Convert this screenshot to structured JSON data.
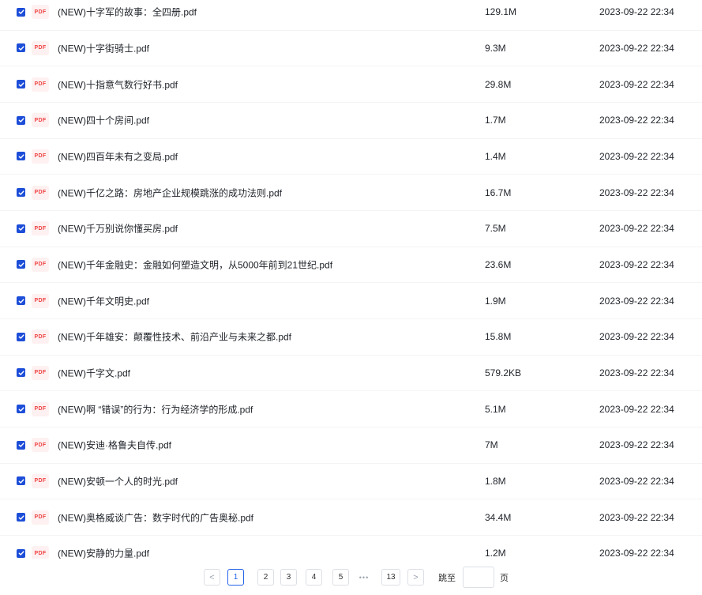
{
  "files": [
    {
      "icon": "pdf-file-icon",
      "badge": "PDF",
      "name": "(NEW)十字军的故事：全四册.pdf",
      "size": "129.1M",
      "date": "2023-09-22 22:34",
      "checked": true
    },
    {
      "icon": "pdf-file-icon",
      "badge": "PDF",
      "name": "(NEW)十字街骑士.pdf",
      "size": "9.3M",
      "date": "2023-09-22 22:34",
      "checked": true
    },
    {
      "icon": "pdf-file-icon",
      "badge": "PDF",
      "name": "(NEW)十指意气数行好书.pdf",
      "size": "29.8M",
      "date": "2023-09-22 22:34",
      "checked": true
    },
    {
      "icon": "pdf-file-icon",
      "badge": "PDF",
      "name": "(NEW)四十个房间.pdf",
      "size": "1.7M",
      "date": "2023-09-22 22:34",
      "checked": true
    },
    {
      "icon": "pdf-file-icon",
      "badge": "PDF",
      "name": "(NEW)四百年未有之变局.pdf",
      "size": "1.4M",
      "date": "2023-09-22 22:34",
      "checked": true
    },
    {
      "icon": "pdf-file-icon",
      "badge": "PDF",
      "name": "(NEW)千亿之路：房地产企业规模跳涨的成功法则.pdf",
      "size": "16.7M",
      "date": "2023-09-22 22:34",
      "checked": true
    },
    {
      "icon": "pdf-file-icon",
      "badge": "PDF",
      "name": "(NEW)千万别说你懂买房.pdf",
      "size": "7.5M",
      "date": "2023-09-22 22:34",
      "checked": true
    },
    {
      "icon": "pdf-file-icon",
      "badge": "PDF",
      "name": "(NEW)千年金融史：金融如何塑造文明，从5000年前到21世纪.pdf",
      "size": "23.6M",
      "date": "2023-09-22 22:34",
      "checked": true
    },
    {
      "icon": "pdf-file-icon",
      "badge": "PDF",
      "name": "(NEW)千年文明史.pdf",
      "size": "1.9M",
      "date": "2023-09-22 22:34",
      "checked": true
    },
    {
      "icon": "pdf-file-icon",
      "badge": "PDF",
      "name": "(NEW)千年雄安：颠覆性技术、前沿产业与未来之都.pdf",
      "size": "15.8M",
      "date": "2023-09-22 22:34",
      "checked": true
    },
    {
      "icon": "pdf-file-icon",
      "badge": "PDF",
      "name": "(NEW)千字文.pdf",
      "size": "579.2KB",
      "date": "2023-09-22 22:34",
      "checked": true
    },
    {
      "icon": "pdf-file-icon",
      "badge": "PDF",
      "name": "(NEW)啊 “错误”的行为：行为经济学的形成.pdf",
      "size": "5.1M",
      "date": "2023-09-22 22:34",
      "checked": true
    },
    {
      "icon": "pdf-file-icon",
      "badge": "PDF",
      "name": "(NEW)安迪·格鲁夫自传.pdf",
      "size": "7M",
      "date": "2023-09-22 22:34",
      "checked": true
    },
    {
      "icon": "pdf-file-icon",
      "badge": "PDF",
      "name": "(NEW)安顿一个人的时光.pdf",
      "size": "1.8M",
      "date": "2023-09-22 22:34",
      "checked": true
    },
    {
      "icon": "pdf-file-icon",
      "badge": "PDF",
      "name": "(NEW)奥格威谈广告：数字时代的广告奥秘.pdf",
      "size": "34.4M",
      "date": "2023-09-22 22:34",
      "checked": true
    },
    {
      "icon": "pdf-file-icon",
      "badge": "PDF",
      "name": "(NEW)安静的力量.pdf",
      "size": "1.2M",
      "date": "2023-09-22 22:34",
      "checked": true
    }
  ],
  "pagination": {
    "prev_icon": "chevron-left-icon",
    "prev_glyph": "<",
    "next_icon": "chevron-right-icon",
    "next_glyph": ">",
    "pages": [
      "1",
      "2",
      "3",
      "4",
      "5"
    ],
    "current_page": "1",
    "ellipsis": "•••",
    "last_page": "13",
    "jump_label": "跳至",
    "jump_value": "",
    "page_suffix": "页"
  },
  "colors": {
    "accent": "#2563eb",
    "checkbox": "#1d4ed8",
    "pdf_badge_text": "#ef4444",
    "pdf_badge_bg": "#fff1f1"
  }
}
